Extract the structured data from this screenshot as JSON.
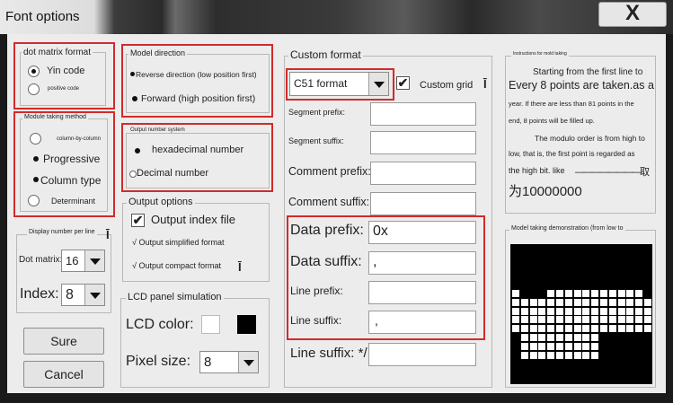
{
  "window": {
    "title": "Font options",
    "close_label": "X"
  },
  "dot_matrix_format": {
    "title": "dot matrix format",
    "options": [
      "Yin code",
      "positive code"
    ],
    "selected": 0
  },
  "module_taking_method": {
    "title": "Module taking method",
    "options": [
      "column-by-column",
      "Progressive",
      "Column type",
      "Determinant"
    ],
    "selected": 1
  },
  "display_number_per_line": {
    "title": "Display number per line",
    "dot_matrix_label": "Dot matrix:",
    "dot_matrix_value": "16",
    "index_label": "Index:",
    "index_value": "8",
    "icon": "i-beam-icon"
  },
  "model_direction": {
    "title": "Model direction",
    "options": [
      "Reverse direction (low position first)",
      "Forward (high position first)"
    ],
    "selected": 1
  },
  "output_number_system": {
    "title": "Output number system",
    "options": [
      "hexadecimal number",
      "Decimal number"
    ],
    "selected": 0
  },
  "output_options": {
    "title": "Output options",
    "index_file_label": "Output index file",
    "index_file_checked": true,
    "simplified_label": "√ Output simplified format",
    "compact_label": "√ Output compact format"
  },
  "lcd_panel": {
    "title": "LCD panel simulation",
    "color_label": "LCD color:",
    "pixel_size_label": "Pixel size:",
    "pixel_size_value": "8",
    "swatch_light": "#ffffff",
    "swatch_dark": "#000000"
  },
  "custom_format": {
    "title": "Custom format",
    "format_value": "C51 format",
    "custom_grid_label": "Custom grid",
    "custom_grid_checked": true,
    "segment_prefix_label": "Segment prefix:",
    "segment_prefix_value": "",
    "segment_suffix_label": "Segment suffix:",
    "segment_suffix_value": "",
    "comment_prefix_label": "Comment prefix:/*\"",
    "comment_suffix_label": "Comment suffix: \",",
    "data_prefix_label": "Data prefix:",
    "data_prefix_value": "0x",
    "data_suffix_label": "Data suffix:",
    "data_suffix_value": ",",
    "line_prefix_label": "Line prefix:",
    "line_prefix_value": "",
    "line_suffix_label": "Line suffix:",
    "line_suffix_value": ",",
    "line_suffix2_label": "Line suffix: */",
    "line_suffix2_value": ""
  },
  "instructions": {
    "title": "Instructions for mold taking",
    "lines": [
      "Starting from the first line to",
      "Every 8 points are taken.as a",
      "year. If there are less than 81 points in the",
      "end, 8 points will be filled up.",
      "The modulo order is from high to",
      "low, that is, the first point is regarded as",
      "the high bit. like",
      "————————取",
      "为10000000"
    ]
  },
  "model_demo": {
    "title": "Model taking demonstration (from low to"
  },
  "buttons": {
    "sure": "Sure",
    "cancel": "Cancel"
  },
  "colors": {
    "highlight_red": "#d22b2b",
    "panel_bg": "#ececec"
  }
}
